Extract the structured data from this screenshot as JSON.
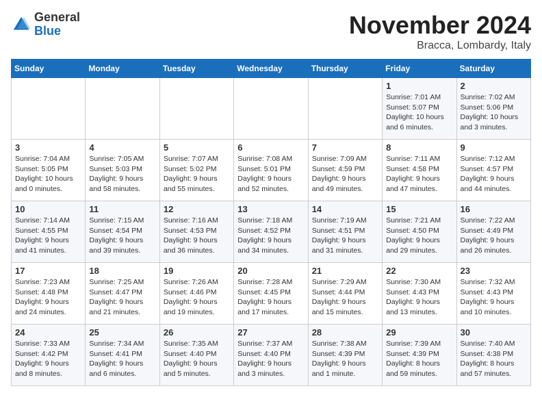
{
  "header": {
    "logo_general": "General",
    "logo_blue": "Blue",
    "month_title": "November 2024",
    "subtitle": "Bracca, Lombardy, Italy"
  },
  "weekdays": [
    "Sunday",
    "Monday",
    "Tuesday",
    "Wednesday",
    "Thursday",
    "Friday",
    "Saturday"
  ],
  "weeks": [
    [
      {
        "day": "",
        "info": ""
      },
      {
        "day": "",
        "info": ""
      },
      {
        "day": "",
        "info": ""
      },
      {
        "day": "",
        "info": ""
      },
      {
        "day": "",
        "info": ""
      },
      {
        "day": "1",
        "info": "Sunrise: 7:01 AM\nSunset: 5:07 PM\nDaylight: 10 hours\nand 6 minutes."
      },
      {
        "day": "2",
        "info": "Sunrise: 7:02 AM\nSunset: 5:06 PM\nDaylight: 10 hours\nand 3 minutes."
      }
    ],
    [
      {
        "day": "3",
        "info": "Sunrise: 7:04 AM\nSunset: 5:05 PM\nDaylight: 10 hours\nand 0 minutes."
      },
      {
        "day": "4",
        "info": "Sunrise: 7:05 AM\nSunset: 5:03 PM\nDaylight: 9 hours\nand 58 minutes."
      },
      {
        "day": "5",
        "info": "Sunrise: 7:07 AM\nSunset: 5:02 PM\nDaylight: 9 hours\nand 55 minutes."
      },
      {
        "day": "6",
        "info": "Sunrise: 7:08 AM\nSunset: 5:01 PM\nDaylight: 9 hours\nand 52 minutes."
      },
      {
        "day": "7",
        "info": "Sunrise: 7:09 AM\nSunset: 4:59 PM\nDaylight: 9 hours\nand 49 minutes."
      },
      {
        "day": "8",
        "info": "Sunrise: 7:11 AM\nSunset: 4:58 PM\nDaylight: 9 hours\nand 47 minutes."
      },
      {
        "day": "9",
        "info": "Sunrise: 7:12 AM\nSunset: 4:57 PM\nDaylight: 9 hours\nand 44 minutes."
      }
    ],
    [
      {
        "day": "10",
        "info": "Sunrise: 7:14 AM\nSunset: 4:55 PM\nDaylight: 9 hours\nand 41 minutes."
      },
      {
        "day": "11",
        "info": "Sunrise: 7:15 AM\nSunset: 4:54 PM\nDaylight: 9 hours\nand 39 minutes."
      },
      {
        "day": "12",
        "info": "Sunrise: 7:16 AM\nSunset: 4:53 PM\nDaylight: 9 hours\nand 36 minutes."
      },
      {
        "day": "13",
        "info": "Sunrise: 7:18 AM\nSunset: 4:52 PM\nDaylight: 9 hours\nand 34 minutes."
      },
      {
        "day": "14",
        "info": "Sunrise: 7:19 AM\nSunset: 4:51 PM\nDaylight: 9 hours\nand 31 minutes."
      },
      {
        "day": "15",
        "info": "Sunrise: 7:21 AM\nSunset: 4:50 PM\nDaylight: 9 hours\nand 29 minutes."
      },
      {
        "day": "16",
        "info": "Sunrise: 7:22 AM\nSunset: 4:49 PM\nDaylight: 9 hours\nand 26 minutes."
      }
    ],
    [
      {
        "day": "17",
        "info": "Sunrise: 7:23 AM\nSunset: 4:48 PM\nDaylight: 9 hours\nand 24 minutes."
      },
      {
        "day": "18",
        "info": "Sunrise: 7:25 AM\nSunset: 4:47 PM\nDaylight: 9 hours\nand 21 minutes."
      },
      {
        "day": "19",
        "info": "Sunrise: 7:26 AM\nSunset: 4:46 PM\nDaylight: 9 hours\nand 19 minutes."
      },
      {
        "day": "20",
        "info": "Sunrise: 7:28 AM\nSunset: 4:45 PM\nDaylight: 9 hours\nand 17 minutes."
      },
      {
        "day": "21",
        "info": "Sunrise: 7:29 AM\nSunset: 4:44 PM\nDaylight: 9 hours\nand 15 minutes."
      },
      {
        "day": "22",
        "info": "Sunrise: 7:30 AM\nSunset: 4:43 PM\nDaylight: 9 hours\nand 13 minutes."
      },
      {
        "day": "23",
        "info": "Sunrise: 7:32 AM\nSunset: 4:43 PM\nDaylight: 9 hours\nand 10 minutes."
      }
    ],
    [
      {
        "day": "24",
        "info": "Sunrise: 7:33 AM\nSunset: 4:42 PM\nDaylight: 9 hours\nand 8 minutes."
      },
      {
        "day": "25",
        "info": "Sunrise: 7:34 AM\nSunset: 4:41 PM\nDaylight: 9 hours\nand 6 minutes."
      },
      {
        "day": "26",
        "info": "Sunrise: 7:35 AM\nSunset: 4:40 PM\nDaylight: 9 hours\nand 5 minutes."
      },
      {
        "day": "27",
        "info": "Sunrise: 7:37 AM\nSunset: 4:40 PM\nDaylight: 9 hours\nand 3 minutes."
      },
      {
        "day": "28",
        "info": "Sunrise: 7:38 AM\nSunset: 4:39 PM\nDaylight: 9 hours\nand 1 minute."
      },
      {
        "day": "29",
        "info": "Sunrise: 7:39 AM\nSunset: 4:39 PM\nDaylight: 8 hours\nand 59 minutes."
      },
      {
        "day": "30",
        "info": "Sunrise: 7:40 AM\nSunset: 4:38 PM\nDaylight: 8 hours\nand 57 minutes."
      }
    ]
  ]
}
